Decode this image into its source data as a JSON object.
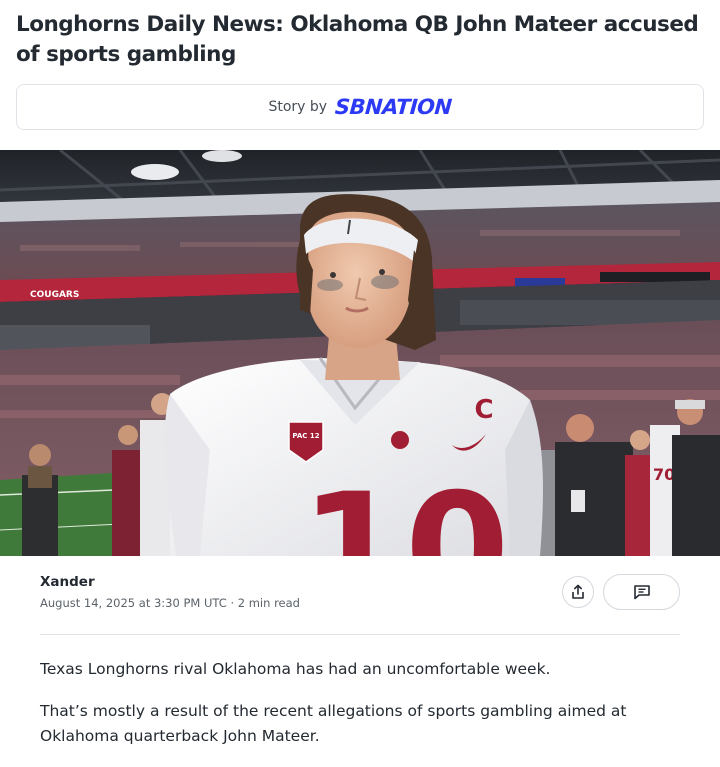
{
  "article": {
    "headline": "Longhorns Daily News: Oklahoma QB John Mateer accused of sports gambling",
    "story_by_label": "Story by",
    "source_logo_text": "SBNATION",
    "hero_image": {
      "jersey_patch": "PAC 12",
      "captain_mark": "C",
      "jersey_number": "10",
      "banner_text": "COUGARS"
    },
    "author": "Xander",
    "published": "August 14, 2025 at 3:30 PM UTC",
    "read_time": "2 min read",
    "paragraphs": [
      "Texas Longhorns rival Oklahoma has had an uncomfortable week.",
      "That’s mostly a result of the recent allegations of sports gambling aimed at Oklahoma quarterback John Mateer."
    ]
  },
  "actions": {
    "share_icon": "share-icon",
    "comment_icon": "comment-icon"
  },
  "colors": {
    "sbnation_blue": "#2d3af5",
    "cougar_crimson": "#a11d33"
  }
}
